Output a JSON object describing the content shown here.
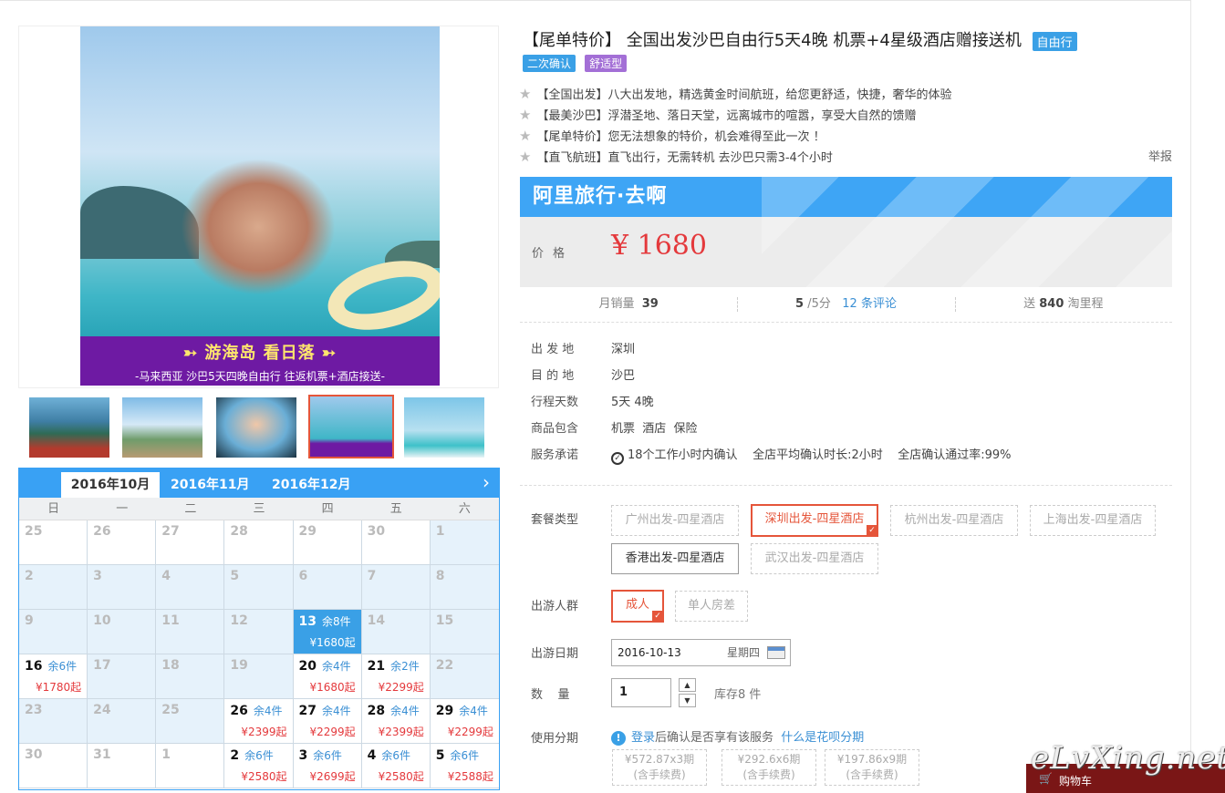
{
  "product": {
    "title": "【尾单特价】 全国出发沙巴自由行5天4晚 机票+4星级酒店赠接送机",
    "tag_free": "自由行",
    "tag_confirm": "二次确认",
    "tag_comfort": "舒适型",
    "banner_main": "➳ 游海岛 看日落 ➳",
    "banner_sub": "-马来西亚 沙巴5天四晚自由行 往返机票+酒店接送-",
    "features": [
      "【全国出发】八大出发地，精选黄金时间航班，给您更舒适，快捷，奢华的体验",
      "【最美沙巴】浮潜圣地、落日天堂，远离城市的喧嚣，享受大自然的馈赠",
      "【尾单特价】您无法想象的特价，机会难得至此一次 ！",
      "【直飞航班】直飞出行，无需转机 去沙巴只需3-4个小时"
    ],
    "report": "举报"
  },
  "price": {
    "brand": "阿里旅行·去啊",
    "label": "价格",
    "value": "¥ 1680"
  },
  "stats": {
    "monthly_label": "月销量",
    "monthly_value": "39",
    "rating_value": "5",
    "rating_suffix": " /5分",
    "reviews": "12 条评论",
    "miles_prefix": "送",
    "miles_value": "840",
    "miles_suffix": "淘里程"
  },
  "info": {
    "depart_k": "出 发 地",
    "depart_v": "深圳",
    "dest_k": "目 的 地",
    "dest_v": "沙巴",
    "days_k": "行程天数",
    "days_v": "5天 4晚",
    "incl_k": "商品包含",
    "incl_v": "机票  酒店  保险",
    "promise_k": "服务承诺",
    "promise_v": "18个工作小时内确认    全店平均确认时长:2小时    全店确认通过率:99%"
  },
  "options": {
    "package_label": "套餐类型",
    "packages": [
      "广州出发-四星酒店",
      "深圳出发-四星酒店",
      "杭州出发-四星酒店",
      "上海出发-四星酒店",
      "香港出发-四星酒店",
      "武汉出发-四星酒店"
    ],
    "crowd_label": "出游人群",
    "crowd": [
      "成人",
      "单人房差"
    ],
    "date_label": "出游日期",
    "date_value": "2016-10-13",
    "date_weekday": "星期四",
    "qty_label": "数    量",
    "qty_value": "1",
    "stock": "库存8 件",
    "install_label": "使用分期",
    "install_login": "登录",
    "install_text": "后确认是否享有该服务",
    "install_link": "什么是花呗分期",
    "plans": [
      {
        "line1": "¥572.87x3期",
        "line2": "(含手续费)"
      },
      {
        "line1": "¥292.6x6期",
        "line2": "(含手续费)"
      },
      {
        "line1": "¥197.86x9期",
        "line2": "(含手续费)"
      }
    ]
  },
  "calendar": {
    "tabs": [
      "2016年10月",
      "2016年11月",
      "2016年12月"
    ],
    "next": "›",
    "weekdays": [
      "日",
      "一",
      "二",
      "三",
      "四",
      "五",
      "六"
    ],
    "rows": [
      [
        {
          "d": "25"
        },
        {
          "d": "26"
        },
        {
          "d": "27"
        },
        {
          "d": "28"
        },
        {
          "d": "29"
        },
        {
          "d": "30"
        },
        {
          "d": "1"
        }
      ],
      [
        {
          "d": "2"
        },
        {
          "d": "3"
        },
        {
          "d": "4"
        },
        {
          "d": "5"
        },
        {
          "d": "6"
        },
        {
          "d": "7"
        },
        {
          "d": "8"
        }
      ],
      [
        {
          "d": "9"
        },
        {
          "d": "10"
        },
        {
          "d": "11"
        },
        {
          "d": "12"
        },
        {
          "d": "13",
          "s": "余8件",
          "p": "¥1680起",
          "sel": true
        },
        {
          "d": "14"
        },
        {
          "d": "15"
        }
      ],
      [
        {
          "d": "16",
          "s": "余6件",
          "p": "¥1780起"
        },
        {
          "d": "17"
        },
        {
          "d": "18"
        },
        {
          "d": "19"
        },
        {
          "d": "20",
          "s": "余4件",
          "p": "¥1680起"
        },
        {
          "d": "21",
          "s": "余2件",
          "p": "¥2299起"
        },
        {
          "d": "22"
        }
      ],
      [
        {
          "d": "23"
        },
        {
          "d": "24"
        },
        {
          "d": "25"
        },
        {
          "d": "26",
          "s": "余4件",
          "p": "¥2399起"
        },
        {
          "d": "27",
          "s": "余4件",
          "p": "¥2299起"
        },
        {
          "d": "28",
          "s": "余4件",
          "p": "¥2399起"
        },
        {
          "d": "29",
          "s": "余4件",
          "p": "¥2299起"
        }
      ],
      [
        {
          "d": "30"
        },
        {
          "d": "31"
        },
        {
          "d": "1"
        },
        {
          "d": "2",
          "s": "余6件",
          "p": "¥2580起"
        },
        {
          "d": "3",
          "s": "余6件",
          "p": "¥2699起"
        },
        {
          "d": "4",
          "s": "余6件",
          "p": "¥2580起"
        },
        {
          "d": "5",
          "s": "余6件",
          "p": "¥2588起"
        }
      ]
    ]
  },
  "cart": {
    "label": "购物车"
  },
  "watermark": "eLvXing.net",
  "colors": {
    "accent": "#39a1f4",
    "price": "#e4393c",
    "selected": "#e5553a",
    "banner": "#6e1aa3"
  }
}
